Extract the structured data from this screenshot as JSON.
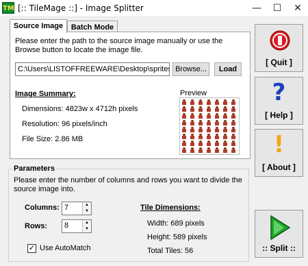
{
  "window": {
    "icon_text": "TM",
    "title": "[:: TileMage ::] - Image Splitter",
    "minimize": "—",
    "maximize": "☐",
    "close": "✕"
  },
  "tabs": [
    {
      "label": "Source Image",
      "active": true
    },
    {
      "label": "Batch Mode",
      "active": false
    }
  ],
  "source": {
    "instruction": "Please enter the path to the source image manually or use the Browse button to locate the image file.",
    "path_value": "C:\\Users\\LISTOFFREEWARE\\Desktop\\spriteshe",
    "browse_label": "Browse...",
    "load_label": "Load"
  },
  "summary": {
    "heading": "Image Summary:",
    "dimensions": "Dimensions: 4823w x 4712h pixels",
    "resolution": "Resolution: 96 pixels/inch",
    "file_size": "File Size: 2.86 MB",
    "preview_label": "Preview"
  },
  "parameters": {
    "legend": "Parameters",
    "instruction": "Please enter the number of columns and rows you want to divide the source image into.",
    "columns_label": "Columns:",
    "columns_value": "7",
    "rows_label": "Rows:",
    "rows_value": "8",
    "automatch_label": "Use AutoMatch",
    "automatch_checked": true,
    "checkmark": "✓"
  },
  "tile_dimensions": {
    "heading": "Tile Dimensions:",
    "width": "Width: 689 pixels",
    "height": "Height: 589 pixels",
    "total": "Total Tiles: 56"
  },
  "side_buttons": {
    "quit": "[ Quit ]",
    "help": "[ Help ]",
    "about": "[ About ]",
    "split": ":: Split ::",
    "help_glyph": "?",
    "about_glyph": "!"
  },
  "colors": {
    "quit_red": "#d9181f",
    "help_blue": "#1d3fbf",
    "about_orange": "#f2a51a",
    "split_green": "#1fa32a"
  }
}
